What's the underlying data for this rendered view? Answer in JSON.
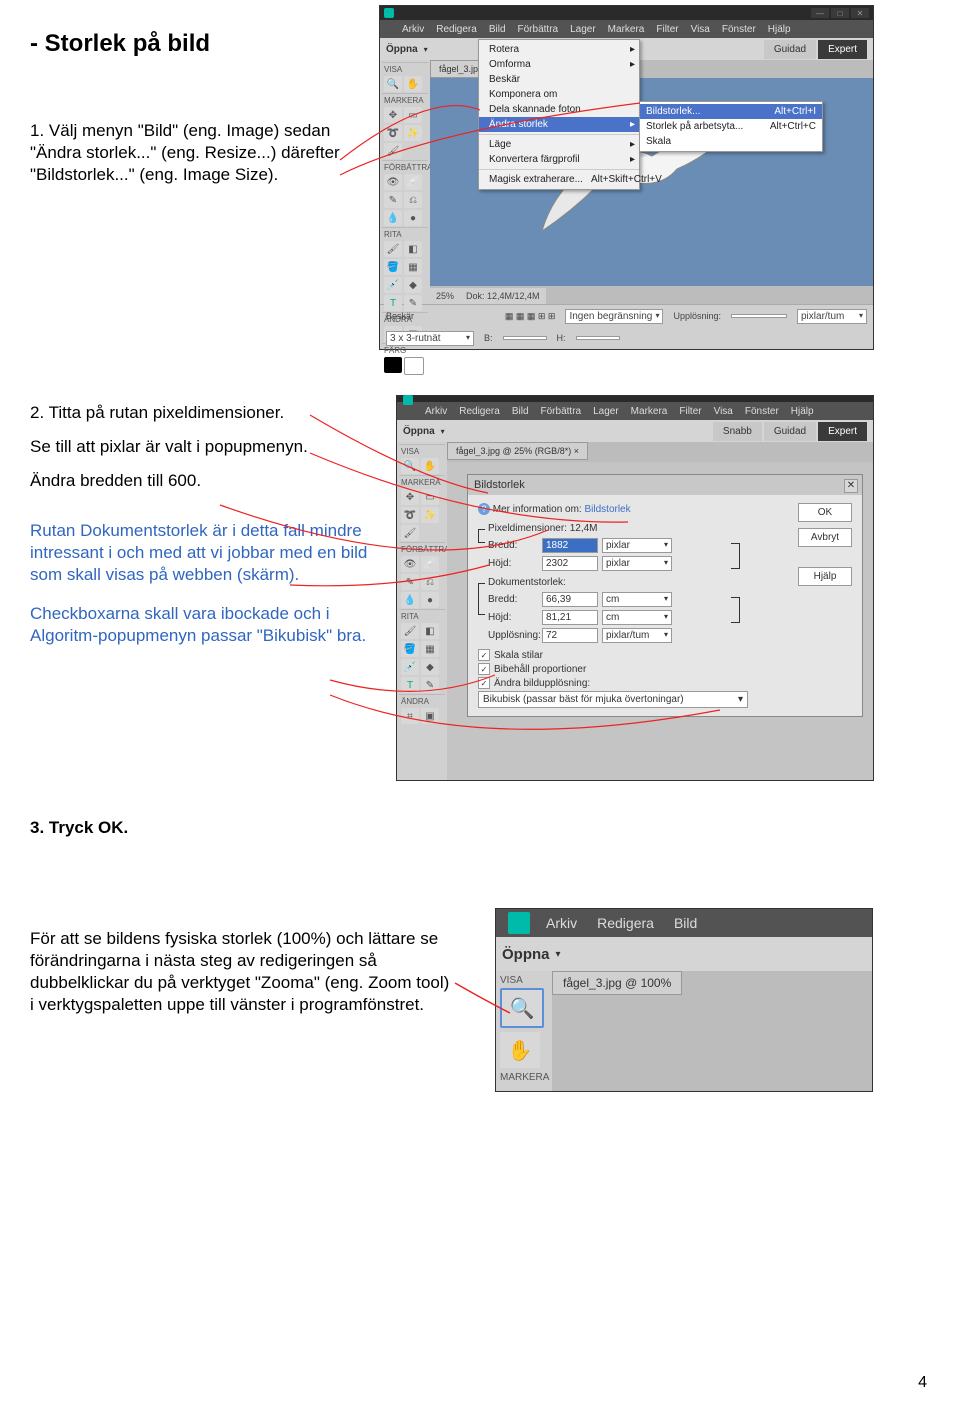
{
  "page": {
    "number": "4"
  },
  "title": "- Storlek på bild",
  "step1": {
    "text": "1. Välj menyn \"Bild\" (eng. Image) sedan \"Ändra storlek...\" (eng. Resize...) därefter \"Bildstorlek...\" (eng. Image Size)."
  },
  "step2": {
    "line1": "2. Titta på rutan pixeldimensioner.",
    "line2": "Se till att pixlar är valt i popupmenyn.",
    "line3": "Ändra bredden till 600.",
    "line4": "Rutan Dokumentstorlek är i detta fall mindre intressant i och med att vi jobbar med en bild som skall visas på webben (skärm).",
    "line5": "Checkboxarna skall vara ibockade och i Algoritm-popupmenyn passar \"Bikubisk\" bra."
  },
  "step3": "3. Tryck OK.",
  "footer": "För att se bildens fysiska storlek (100%) och lättare se förändringarna i nästa steg av redigeringen så dubbelklickar du på verktyget \"Zooma\" (eng. Zoom tool) i verktygspaletten uppe till vänster i programfönstret.",
  "pse": {
    "menus": [
      "Arkiv",
      "Redigera",
      "Bild",
      "Förbättra",
      "Lager",
      "Markera",
      "Filter",
      "Visa",
      "Fönster",
      "Hjälp"
    ],
    "open": "Öppna",
    "modes": {
      "guided": "Guidad",
      "expert": "Expert"
    },
    "tab1": "fågel_3.jpg ×",
    "zoom": "25%",
    "dok": "Dok: 12,4M/12,4M",
    "toolGroups": {
      "visa": "VISA",
      "markera": "MARKERA",
      "forbattra": "FÖRBÄTTRA",
      "rita": "RITA",
      "andra": "ÄNDRA",
      "farg": "FÄRG"
    },
    "optbar": {
      "beskar": "Beskär",
      "nobound": "Ingen begränsning",
      "uppl": "Upplösning:",
      "unit": "pixlar/tum",
      "grid": "3 x 3-rutnät",
      "b": "B:",
      "h": "H:"
    },
    "dd": {
      "rotera": "Rotera",
      "omforma": "Omforma",
      "beskar": "Beskär",
      "komponera": "Komponera om",
      "dela": "Dela skannade foton",
      "andra": "Ändra storlek",
      "lage": "Läge",
      "konv": "Konvertera färgprofil",
      "magisk": "Magisk extraherare...",
      "magisk_sc": "Alt+Skift+Ctrl+V"
    },
    "sub": {
      "bild": "Bildstorlek...",
      "bild_sc": "Alt+Ctrl+I",
      "arb": "Storlek på arbetsyta...",
      "arb_sc": "Alt+Ctrl+C",
      "skala": "Skala"
    }
  },
  "pse2": {
    "snabb": "Snabb",
    "guided": "Guidad",
    "expert": "Expert",
    "tab": "fågel_3.jpg @ 25% (RGB/8*) ×"
  },
  "dlg": {
    "title": "Bildstorlek",
    "more": "Mer information om:",
    "more_link": "Bildstorlek",
    "pixdim": "Pixeldimensioner: 12,4M",
    "bredd": "Bredd:",
    "hojd": "Höjd:",
    "uppl": "Upplösning:",
    "bredd_v": "1882",
    "hojd_v": "2302",
    "pixlar": "pixlar",
    "docsize": "Dokumentstorlek:",
    "bredd2_v": "66,39",
    "hojd2_v": "81,21",
    "cm": "cm",
    "uppl_v": "72",
    "ptum": "pixlar/tum",
    "c1": "Skala stilar",
    "c2": "Bibehåll proportioner",
    "c3": "Ändra bildupplösning:",
    "algo": "Bikubisk (passar bäst för mjuka övertoningar)",
    "ok": "OK",
    "avbryt": "Avbryt",
    "hjalp": "Hjälp"
  },
  "sc3": {
    "menus": [
      "Arkiv",
      "Redigera",
      "Bild"
    ],
    "open": "Öppna",
    "visa": "VISA",
    "markera": "MARKERA",
    "tab": "fågel_3.jpg @ 100%"
  }
}
